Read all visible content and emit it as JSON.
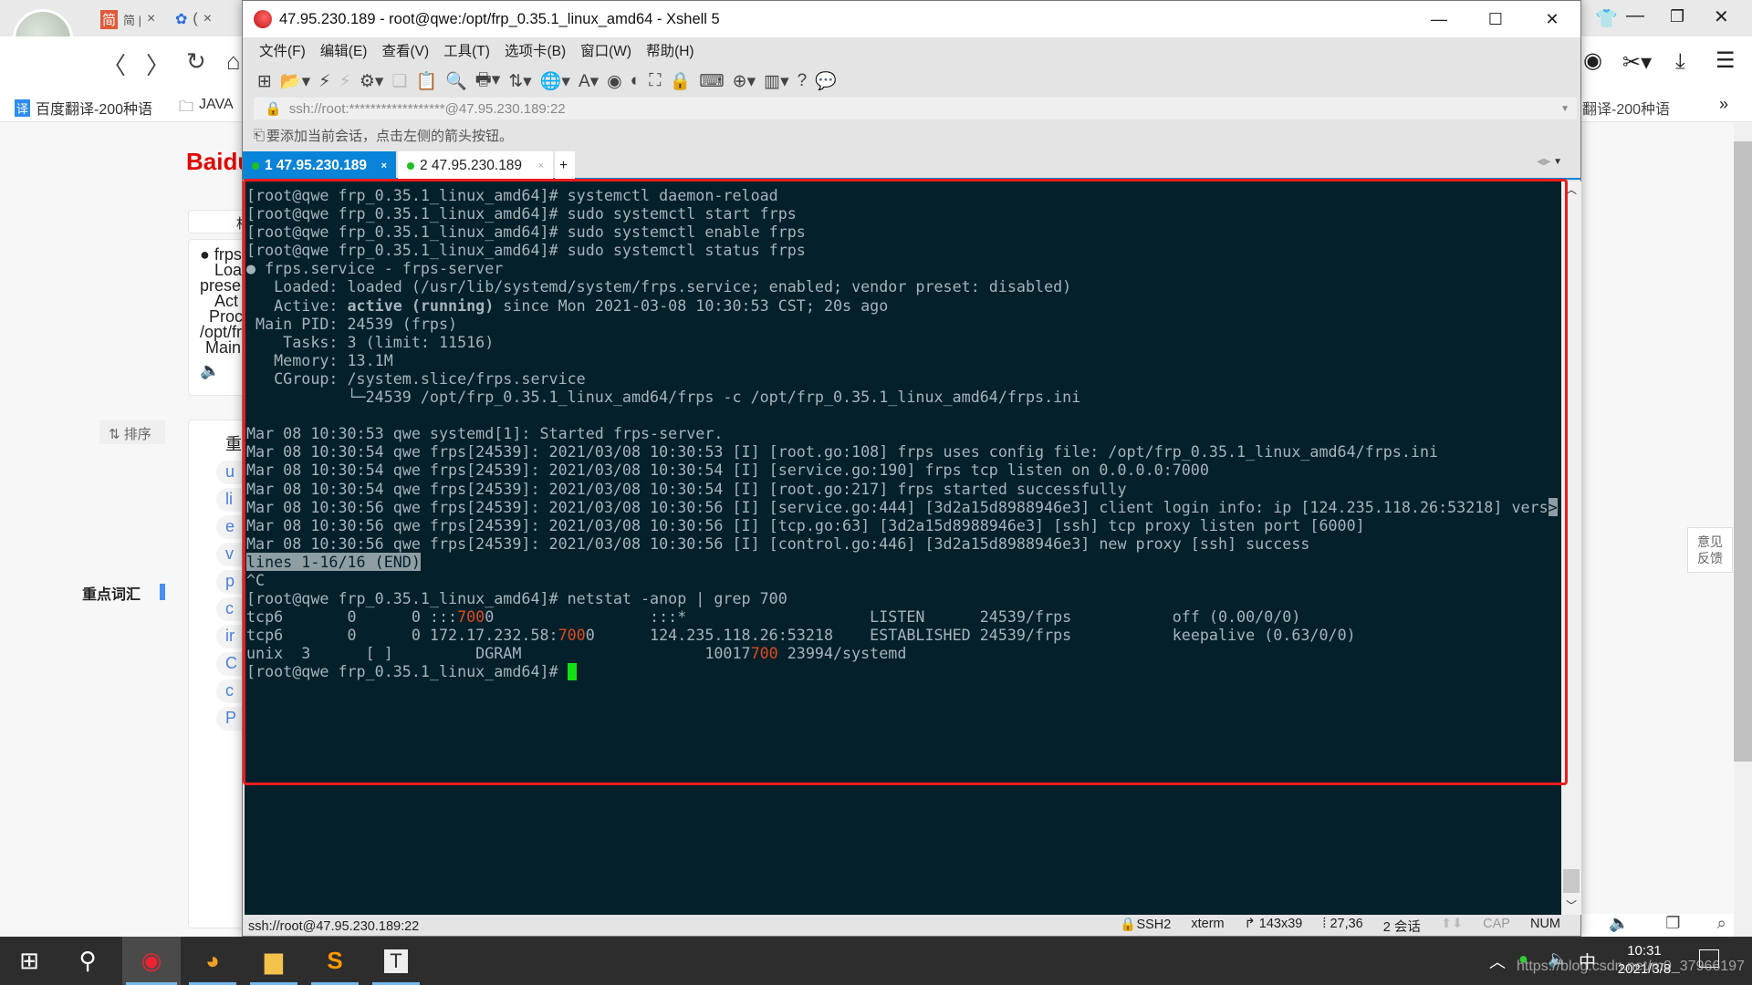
{
  "browser": {
    "tabs": [
      {
        "label": "简 |",
        "icon": "jianshu-icon"
      },
      {
        "label": "(",
        "icon": "baidu-paw-icon"
      }
    ],
    "bookmarks": [
      {
        "label": "百度翻译-200种语",
        "icon": "translate-icon"
      },
      {
        "label": "JAVA",
        "icon": "folder-icon"
      }
    ],
    "bookmark_right": "翻译-200种语",
    "more": "»",
    "baidu_logo": "Baidu",
    "snippet_lines": [
      "● frps",
      "Loa",
      "prese",
      "Act",
      "Proc",
      "/opt/fr",
      "Main"
    ],
    "sort_label": "排序",
    "key_vocab": "重点词汇",
    "vocab_heading": "重",
    "vocab_items": [
      "u",
      "li",
      "e",
      "v",
      "p",
      "c",
      "ir",
      "C",
      "c",
      "P"
    ],
    "top_box": "相",
    "feedback": "意见反馈"
  },
  "xshell": {
    "title": "47.95.230.189 - root@qwe:/opt/frp_0.35.1_linux_amd64 - Xshell 5",
    "menu": [
      "文件(F)",
      "编辑(E)",
      "查看(V)",
      "工具(T)",
      "选项卡(B)",
      "窗口(W)",
      "帮助(H)"
    ],
    "address": "ssh://root:******************@47.95.230.189:22",
    "hint": "要添加当前会话，点击左侧的箭头按钮。",
    "tabs": [
      {
        "label": "1 47.95.230.189",
        "active": true
      },
      {
        "label": "2 47.95.230.189",
        "active": false
      }
    ],
    "add_tab": "+",
    "terminal": [
      [
        {
          "t": "[root@qwe frp_0.35.1_linux_amd64]# systemctl daemon-reload"
        }
      ],
      [
        {
          "t": "[root@qwe frp_0.35.1_linux_amd64]# sudo systemctl start frps"
        }
      ],
      [
        {
          "t": "[root@qwe frp_0.35.1_linux_amd64]# sudo systemctl enable frps"
        }
      ],
      [
        {
          "t": "[root@qwe frp_0.35.1_linux_amd64]# sudo systemctl status frps"
        }
      ],
      [
        {
          "t": "● frps.service - frps-server"
        }
      ],
      [
        {
          "t": "   Loaded: loaded (/usr/lib/systemd/system/frps.service; enabled; vendor preset: disabled)"
        }
      ],
      [
        {
          "t": "   Active: "
        },
        {
          "t": "active (running)",
          "s": "bold"
        },
        {
          "t": " since Mon 2021-03-08 10:30:53 CST; 20s ago"
        }
      ],
      [
        {
          "t": " Main PID: 24539 (frps)"
        }
      ],
      [
        {
          "t": "    Tasks: 3 (limit: 11516)"
        }
      ],
      [
        {
          "t": "   Memory: 13.1M"
        }
      ],
      [
        {
          "t": "   CGroup: /system.slice/frps.service"
        }
      ],
      [
        {
          "t": "           └─24539 /opt/frp_0.35.1_linux_amd64/frps -c /opt/frp_0.35.1_linux_amd64/frps.ini"
        }
      ],
      [
        {
          "t": ""
        }
      ],
      [
        {
          "t": "Mar 08 10:30:53 qwe systemd[1]: Started frps-server."
        }
      ],
      [
        {
          "t": "Mar 08 10:30:54 qwe frps[24539]: 2021/03/08 10:30:53 [I] [root.go:108] frps uses config file: /opt/frp_0.35.1_linux_amd64/frps.ini"
        }
      ],
      [
        {
          "t": "Mar 08 10:30:54 qwe frps[24539]: 2021/03/08 10:30:54 [I] [service.go:190] frps tcp listen on 0.0.0.0:7000"
        }
      ],
      [
        {
          "t": "Mar 08 10:30:54 qwe frps[24539]: 2021/03/08 10:30:54 [I] [root.go:217] frps started successfully"
        }
      ],
      [
        {
          "t": "Mar 08 10:30:56 qwe frps[24539]: 2021/03/08 10:30:56 [I] [service.go:444] [3d2a15d8988946e3] client login info: ip [124.235.118.26:53218] vers"
        },
        {
          "t": ">",
          "s": "rev"
        }
      ],
      [
        {
          "t": "Mar 08 10:30:56 qwe frps[24539]: 2021/03/08 10:30:56 [I] [tcp.go:63] [3d2a15d8988946e3] [ssh] tcp proxy listen port [6000]"
        }
      ],
      [
        {
          "t": "Mar 08 10:30:56 qwe frps[24539]: 2021/03/08 10:30:56 [I] [control.go:446] [3d2a15d8988946e3] new proxy [ssh] success"
        }
      ],
      [
        {
          "t": "lines 1-16/16 (END)",
          "s": "rev"
        }
      ],
      [
        {
          "t": "^C"
        }
      ],
      [
        {
          "t": "[root@qwe frp_0.35.1_linux_amd64]# netstat -anop | grep 700"
        }
      ],
      [
        {
          "t": "tcp6       0      0 :::"
        },
        {
          "t": "700",
          "s": "hl"
        },
        {
          "t": "0                 :::*                    LISTEN      24539/frps           off (0.00/0/0)"
        }
      ],
      [
        {
          "t": "tcp6       0      0 172.17.232.58:"
        },
        {
          "t": "700",
          "s": "hl"
        },
        {
          "t": "0      124.235.118.26:53218    ESTABLISHED 24539/frps           keepalive (0.63/0/0)"
        }
      ],
      [
        {
          "t": "unix  3      [ ]         DGRAM                    10017"
        },
        {
          "t": "700",
          "s": "hl"
        },
        {
          "t": " 23994/systemd"
        }
      ],
      [
        {
          "t": "[root@qwe frp_0.35.1_linux_amd64]# "
        },
        {
          "t": "",
          "s": "cursor"
        }
      ]
    ],
    "status": {
      "connection": "ssh://root@47.95.230.189:22",
      "protocol": "SSH2",
      "term": "xterm",
      "size": "143x39",
      "cursor_pos": "27,36",
      "sessions": "2 会话",
      "cap": "CAP",
      "num": "NUM"
    }
  },
  "taskbar": {
    "apps": [
      {
        "name": "xshell",
        "icon": "xshell-icon",
        "active": true
      },
      {
        "name": "chrome",
        "icon": "browser-icon"
      },
      {
        "name": "explorer",
        "icon": "folder-icon"
      },
      {
        "name": "sublime",
        "icon": "sublime-icon"
      },
      {
        "name": "typora",
        "icon": "typora-icon"
      }
    ],
    "ime": "中",
    "time": "10:31",
    "date": "2021/3/8",
    "watermark": "https://blog.csdn.net/m0_37966197"
  },
  "colors": {
    "terminal_bg": "#03202b",
    "terminal_fg": "#a6b4ba",
    "highlight": "#e04a1b",
    "cursor": "#12e012",
    "annotation_box": "#f01c1c",
    "active_tab": "#0a84d8"
  }
}
